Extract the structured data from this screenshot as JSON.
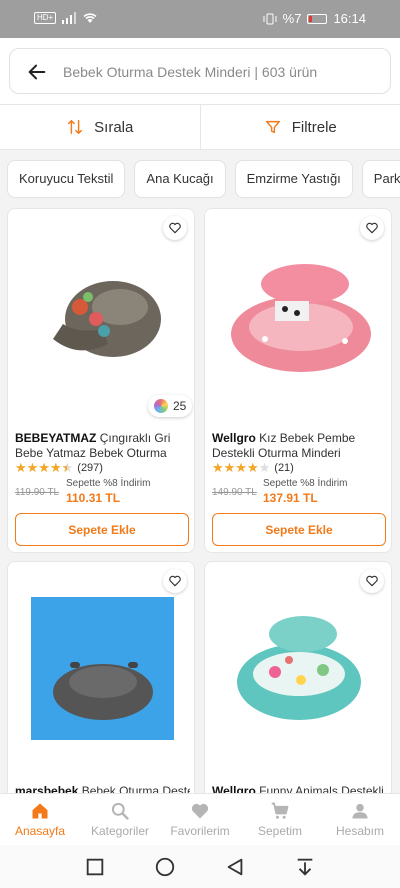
{
  "status_bar": {
    "hd_label": "HD+",
    "battery_text": "%7",
    "time": "16:14"
  },
  "search": {
    "text": "Bebek Oturma Destek Minderi | 603 ürün"
  },
  "actions": {
    "sort_label": "Sırala",
    "filter_label": "Filtrele"
  },
  "chips": [
    "Koruyucu Tekstil",
    "Ana Kucağı",
    "Emzirme Yastığı",
    "Park Yatak"
  ],
  "products": [
    {
      "brand": "BEBEYATMAZ",
      "name": "Çıngıraklı Gri Bebe Yatmaz Bebek Oturma Destek ...",
      "rating": 4.5,
      "review_count": "(297)",
      "old_price": "119.90 TL",
      "discount_text": "Sepette %8 İndirim",
      "new_price": "110.31 TL",
      "add_label": "Sepete Ekle",
      "color_count": "25"
    },
    {
      "brand": "Wellgro",
      "name": "Kız Bebek Pembe Destekli Oturma Minderi",
      "rating": 4,
      "review_count": "(21)",
      "old_price": "149.90 TL",
      "discount_text": "Sepette %8 İndirim",
      "new_price": "137.91 TL",
      "add_label": "Sepete Ekle"
    },
    {
      "brand": "marsbebek",
      "name": "Bebek Oturma Destek"
    },
    {
      "brand": "Wellgro",
      "name": "Funny Animals Destekli"
    }
  ],
  "bottom_nav": [
    {
      "label": "Anasayfa",
      "icon": "home-icon",
      "active": true
    },
    {
      "label": "Kategoriler",
      "icon": "search-icon",
      "active": false
    },
    {
      "label": "Favorilerim",
      "icon": "heart-icon",
      "active": false
    },
    {
      "label": "Sepetim",
      "icon": "cart-icon",
      "active": false
    },
    {
      "label": "Hesabım",
      "icon": "user-icon",
      "active": false
    }
  ],
  "colors": {
    "accent": "#f27a1a",
    "star": "#f5a623"
  }
}
